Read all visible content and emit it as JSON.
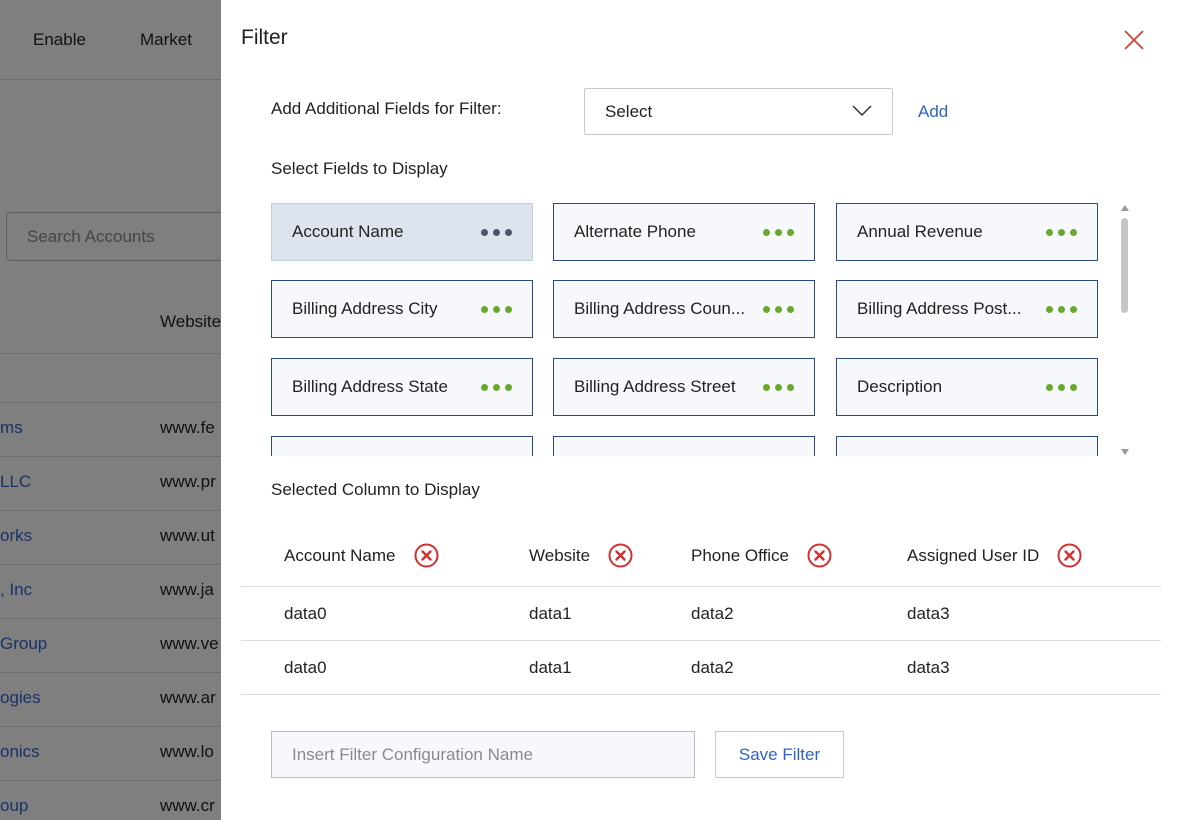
{
  "background": {
    "nav": [
      "Enable",
      "Market"
    ],
    "search_placeholder": "Search Accounts",
    "column_header": "Website",
    "rows": [
      {
        "account": "ms",
        "website": "www.fe"
      },
      {
        "account": "LLC",
        "website": "www.pr"
      },
      {
        "account": "orks",
        "website": "www.ut"
      },
      {
        "account": ", Inc",
        "website": "www.ja"
      },
      {
        "account": "Group",
        "website": "www.ve"
      },
      {
        "account": "ogies",
        "website": "www.ar"
      },
      {
        "account": "onics",
        "website": "www.lo"
      },
      {
        "account": "oup",
        "website": "www.cr"
      }
    ]
  },
  "modal": {
    "title": "Filter",
    "add_fields_label": "Add Additional Fields for Filter:",
    "select_value": "Select",
    "add_label": "Add",
    "display_fields_label": "Select Fields to Display",
    "fields": [
      {
        "label": "Account Name",
        "selected": true
      },
      {
        "label": "Alternate Phone",
        "selected": false
      },
      {
        "label": "Annual Revenue",
        "selected": false
      },
      {
        "label": "Billing Address City",
        "selected": false
      },
      {
        "label": "Billing Address Coun...",
        "selected": false
      },
      {
        "label": "Billing Address Post...",
        "selected": false
      },
      {
        "label": "Billing Address State",
        "selected": false
      },
      {
        "label": "Billing Address Street",
        "selected": false
      },
      {
        "label": "Description",
        "selected": false
      },
      {
        "label": "",
        "selected": false
      },
      {
        "label": "",
        "selected": false
      },
      {
        "label": "",
        "selected": false
      }
    ],
    "selected_columns_label": "Selected Column to Display",
    "columns": [
      "Account Name",
      "Website",
      "Phone Office",
      "Assigned User ID"
    ],
    "rows": [
      [
        "data0",
        "data1",
        "data2",
        "data3"
      ],
      [
        "data0",
        "data1",
        "data2",
        "data3"
      ]
    ],
    "config_placeholder": "Insert Filter Configuration Name",
    "save_label": "Save Filter"
  },
  "colors": {
    "accent": "#2f63c8",
    "dots_green": "#6aa82d",
    "remove_red": "#d32f2f",
    "card_border": "#2b4c80"
  }
}
